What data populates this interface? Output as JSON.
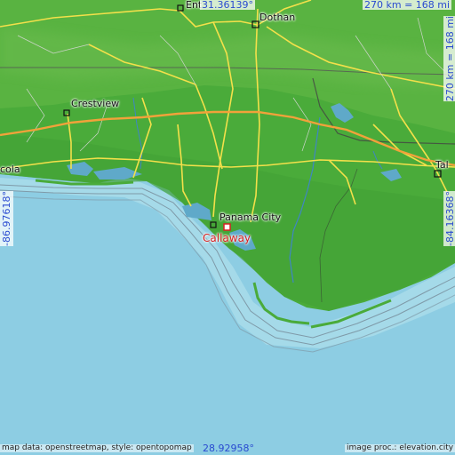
{
  "map": {
    "target_place": "Callaway",
    "cities": {
      "dothan": "Dothan",
      "crestview": "Crestview",
      "panama_city": "Panama City",
      "pensacola_partial": "cola",
      "tallahassee_partial": "Tal",
      "enterprise_partial": "Ent"
    },
    "bounds": {
      "north": "31.36139°",
      "south": "28.92958°",
      "west": "-86.97618°",
      "east": "-84.16368°"
    },
    "scale": {
      "horizontal": "270 km = 168 mi",
      "vertical": "270 km = 168 mi"
    },
    "credits": {
      "map_data": "map data: openstreetmap, style: opentopomap",
      "image_proc": "image proc.: elevation.city"
    },
    "colors": {
      "sea": "#8dcde3",
      "lowland": "#4aab3a",
      "upland": "#62b446",
      "roads": "#f3e04a",
      "interstate": "#f1a23a",
      "target": "#d62020",
      "coord_text": "#2a4bd0"
    }
  }
}
